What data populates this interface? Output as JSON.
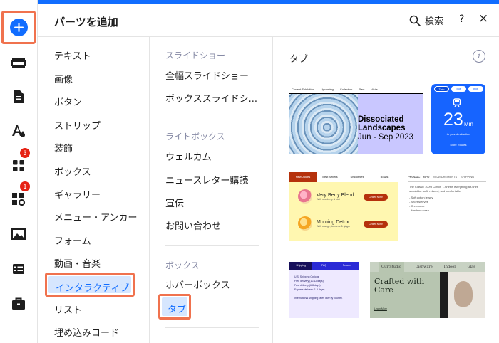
{
  "rail": {
    "badges": {
      "apps": "3",
      "settings": "1"
    }
  },
  "header": {
    "title": "パーツを追加",
    "search_label": "検索",
    "help": "?",
    "close": "×"
  },
  "categories": [
    "テキスト",
    "画像",
    "ボタン",
    "ストリップ",
    "装飾",
    "ボックス",
    "ギャラリー",
    "メニュー・アンカー",
    "フォーム",
    "動画・音楽",
    "インタラクティブ",
    "リスト",
    "埋め込みコード"
  ],
  "subcategories": {
    "slideshow_heading": "スライドショー",
    "slideshow_items": [
      "全幅スライドショー",
      "ボックススライドシ..."
    ],
    "lightbox_heading": "ライトボックス",
    "lightbox_items": [
      "ウェルカム",
      "ニュースレター購読",
      "宣伝",
      "お問い合わせ"
    ],
    "box_heading": "ボックス",
    "box_items": [
      "ホバーボックス",
      "タブ"
    ]
  },
  "section": {
    "title": "タブ",
    "info": "i"
  },
  "thumbnails": {
    "t1": {
      "tabs": [
        "Current Exhibition",
        "Upcoming",
        "Collection",
        "Past",
        "Visits"
      ],
      "title": "Dissociated Landscapes",
      "dates": "Jun - Sep 2023"
    },
    "t2": {
      "tabs": [
        "Train",
        "Bus",
        "Bike"
      ],
      "number": "23",
      "unit": "Min",
      "sub": "to your destination",
      "link": "More Routes"
    },
    "t3": {
      "tabs": [
        "New Juices",
        "Best Sellers",
        "Smoothies",
        "Bowls"
      ],
      "items": [
        {
          "name": "Very Berry Blend",
          "desc": "With raspberry & kiwi",
          "button": "Order Now"
        },
        {
          "name": "Morning Detox",
          "desc": "With orange, turmeric & ginger",
          "button": "Order Now"
        }
      ]
    },
    "t4": {
      "tabs": [
        "PRODUCT INFO",
        "MEASUREMENTS",
        "SHIPPING"
      ],
      "body": "The Classic 100% Cotton T-Shirt is everything a t-shirt should be: soft, relaxed, and comfortable.",
      "bullets": [
        "- Soft cotton jersey",
        "- Short sleeves",
        "- Crew neck",
        "- Machine wash"
      ]
    },
    "t5": {
      "tabs": [
        "Shipping",
        "FAQ",
        "Returns"
      ],
      "lines": [
        "U.S. Shipping Options",
        "Free delivery (10-12 days)",
        "Fast delivery (6-8 days)",
        "Express delivery (1-3 days)",
        "International shipping rates vary by country."
      ]
    },
    "t6": {
      "tabs": [
        "Our Studio",
        "Dishware",
        "Indoor",
        "Glas"
      ],
      "title": "Crafted with Care",
      "link": "Learn More"
    }
  },
  "colors": {
    "accent": "#116dff",
    "highlight_border": "#f0724e",
    "selected_bg": "#d6e6fe",
    "badge": "#e62214"
  }
}
